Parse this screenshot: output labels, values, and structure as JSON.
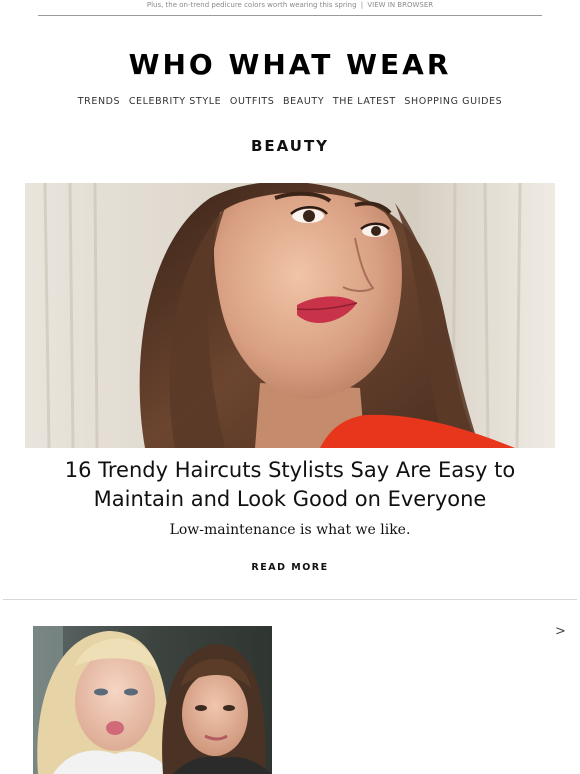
{
  "preheader": {
    "text": "Plus, the on-trend pedicure colors worth wearing this spring",
    "separator": "|",
    "view_link": "VIEW IN BROWSER"
  },
  "logo": "WHO WHAT WEAR",
  "nav": [
    {
      "label": "TRENDS"
    },
    {
      "label": "CELEBRITY STYLE"
    },
    {
      "label": "OUTFITS"
    },
    {
      "label": "BEAUTY"
    },
    {
      "label": "THE LATEST"
    },
    {
      "label": "SHOPPING GUIDES"
    }
  ],
  "section_title": "BEAUTY",
  "article": {
    "headline": "16 Trendy Haircuts Stylists Say Are Easy to Maintain and Look Good on Everyone",
    "dek": "Low-maintenance is what we like.",
    "cta": "READ MORE"
  },
  "next_article": {
    "arrow": ">"
  },
  "colors": {
    "rule": "#9a9a9a",
    "divider": "#d8d8d8",
    "lip": "#c8334a",
    "top_red": "#e8361c"
  }
}
